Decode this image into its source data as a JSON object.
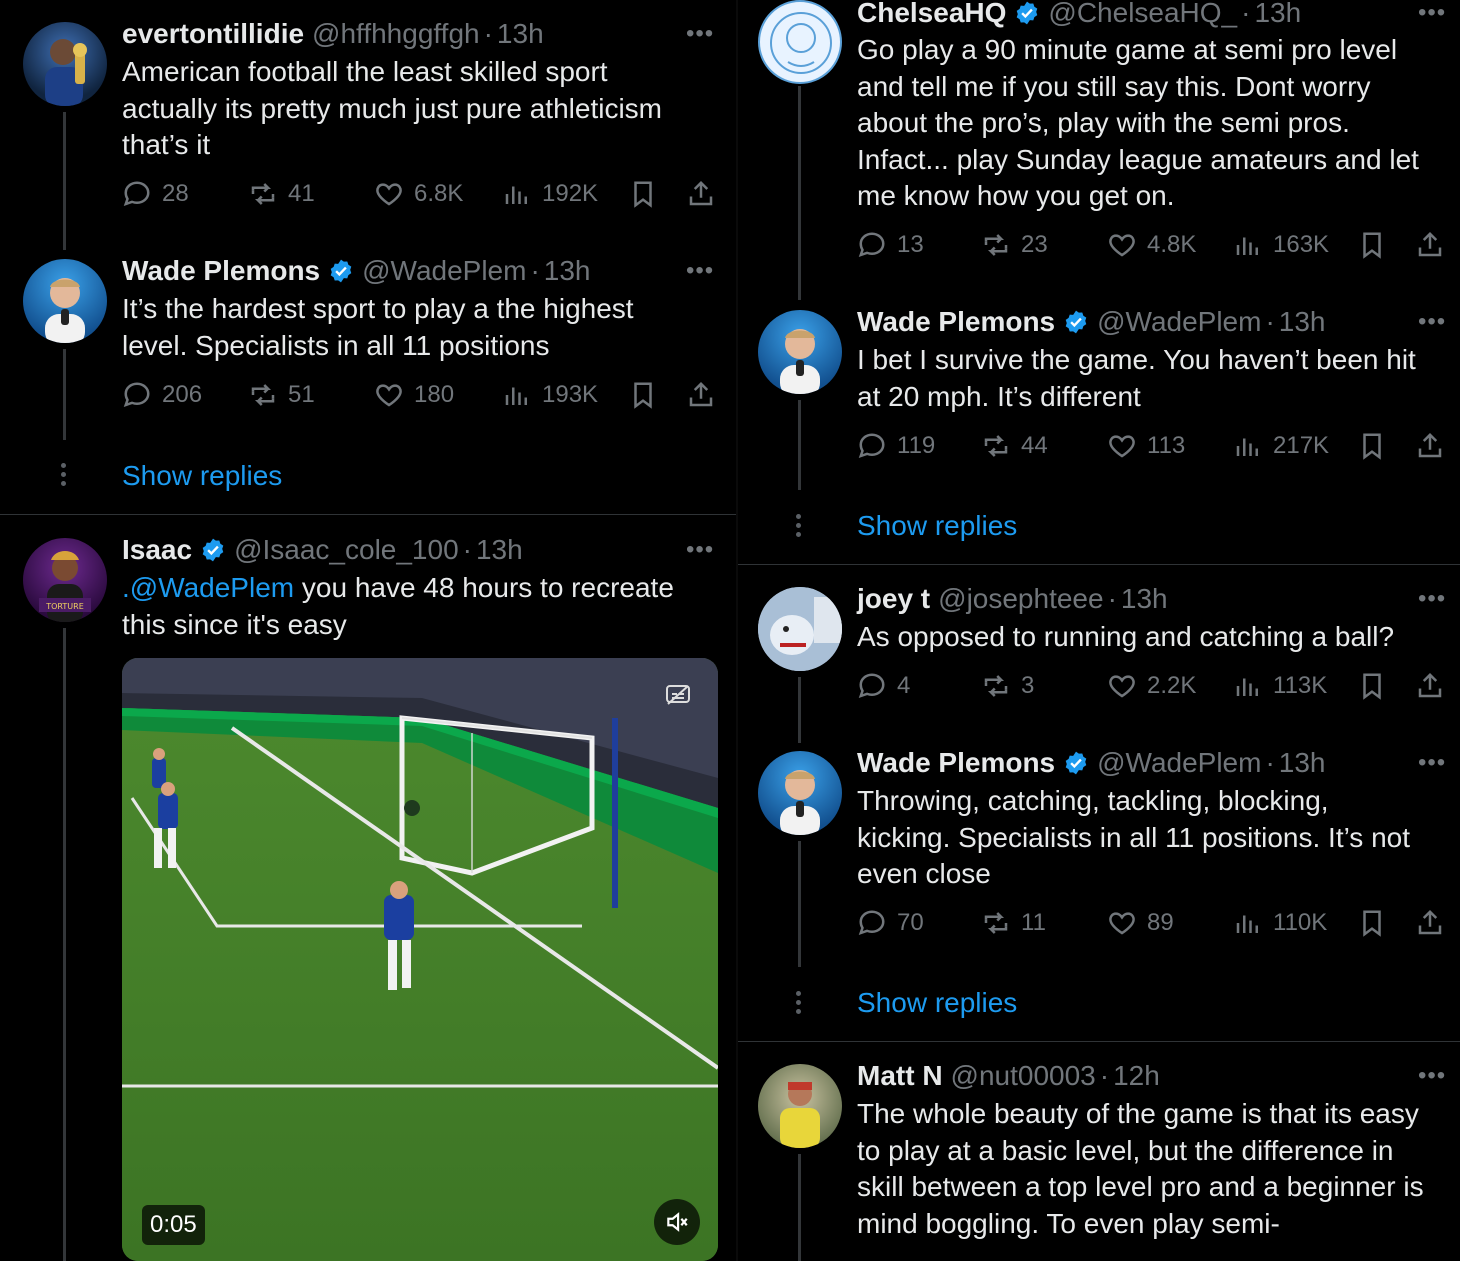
{
  "left_column": {
    "tweets": [
      {
        "name": "evertontillidie",
        "handle": "@hffhhggffgh",
        "time": "13h",
        "verified": false,
        "text_lines": [
          "American football the least skilled sport",
          "actually its pretty much just pure athleticism",
          "that’s it"
        ],
        "replies": "28",
        "reposts": "41",
        "likes": "6.8K",
        "views": "192K"
      },
      {
        "name": "Wade Plemons",
        "handle": "@WadePlem",
        "time": "13h",
        "verified": true,
        "text_lines": [
          "It’s the hardest sport to play a the highest",
          "level. Specialists in all 11 positions"
        ],
        "replies": "206",
        "reposts": "51",
        "likes": "180",
        "views": "193K"
      }
    ],
    "show_replies": "Show replies",
    "video_tweet": {
      "name": "Isaac",
      "handle": "@Isaac_cole_100",
      "time": "13h",
      "verified": true,
      "mention": ".@WadePlem",
      "text_after_mention": " you have 48 hours to recreate",
      "text_line2": "this since it's easy",
      "video_duration": "0:05",
      "avatar_caption": "TORTURE"
    }
  },
  "right_column": {
    "tweets": [
      {
        "name": "ChelseaHQ",
        "handle": "@ChelseaHQ_",
        "time": "13h",
        "verified": true,
        "text_lines": [
          "Go play a 90 minute game at semi pro level",
          "and tell me if you still say this. Dont worry",
          "about the pro’s, play with the semi pros.",
          "Infact... play Sunday league amateurs and let",
          "me know how you get on."
        ],
        "replies": "13",
        "reposts": "23",
        "likes": "4.8K",
        "views": "163K"
      },
      {
        "name": "Wade Plemons",
        "handle": "@WadePlem",
        "time": "13h",
        "verified": true,
        "text_lines": [
          "I bet I survive the game. You haven’t been hit",
          "at 20 mph. It’s different"
        ],
        "replies": "119",
        "reposts": "44",
        "likes": "113",
        "views": "217K"
      },
      {
        "name": "joey t",
        "handle": "@josephteee",
        "time": "13h",
        "verified": false,
        "text_lines": [
          "As opposed to running and catching a ball?"
        ],
        "replies": "4",
        "reposts": "3",
        "likes": "2.2K",
        "views": "113K"
      },
      {
        "name": "Wade Plemons",
        "handle": "@WadePlem",
        "time": "13h",
        "verified": true,
        "text_lines": [
          "Throwing, catching, tackling, blocking,",
          "kicking. Specialists in all 11 positions. It’s not",
          "even close"
        ],
        "replies": "70",
        "reposts": "11",
        "likes": "89",
        "views": "110K"
      },
      {
        "name": "Matt N",
        "handle": "@nut00003",
        "time": "12h",
        "verified": false,
        "text_lines": [
          "The whole beauty of the game is that its easy",
          "to play at a basic level, but the difference in",
          "skill between a top level pro and a beginner is",
          "mind boggling. To even play semi-"
        ]
      }
    ],
    "show_replies": "Show replies"
  },
  "colors": {
    "background": "#000000",
    "text": "#e7e9ea",
    "muted": "#71767b",
    "accent": "#1d9bf0",
    "divider": "#2f3336"
  },
  "icons": [
    "reply-icon",
    "repost-icon",
    "like-icon",
    "views-icon",
    "bookmark-icon",
    "share-icon",
    "verified-icon",
    "more-icon",
    "mute-icon",
    "captions-icon"
  ]
}
